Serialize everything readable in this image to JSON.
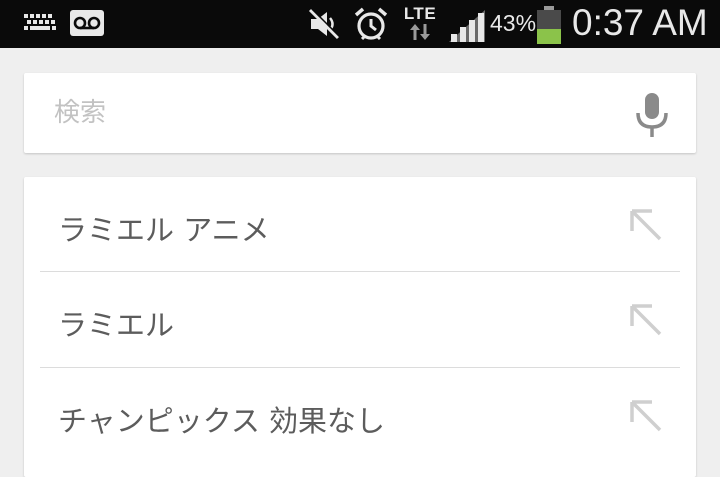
{
  "status_bar": {
    "icons": [
      "keyboard-icon",
      "voicemail-icon",
      "mute-icon",
      "alarm-icon",
      "lte-icon",
      "signal-icon",
      "battery-icon"
    ],
    "network": "LTE",
    "battery_percent": "43%",
    "battery_level": 0.43,
    "time": "0:37 AM"
  },
  "search": {
    "placeholder": "検索",
    "value": "",
    "icon": "mic-icon"
  },
  "suggestions": [
    {
      "label": "ラミエル アニメ",
      "icon": "arrow-up-left-icon"
    },
    {
      "label": "ラミエル",
      "icon": "arrow-up-left-icon"
    },
    {
      "label": "チャンピックス 効果なし",
      "icon": "arrow-up-left-icon"
    }
  ],
  "colors": {
    "status_bar_bg": "#0a0a0a",
    "page_bg": "#efefef",
    "card_bg": "#ffffff",
    "battery_fill": "#8bc34a",
    "suggestion_text": "#5c5c5c",
    "placeholder_text": "#c2c2c2"
  }
}
